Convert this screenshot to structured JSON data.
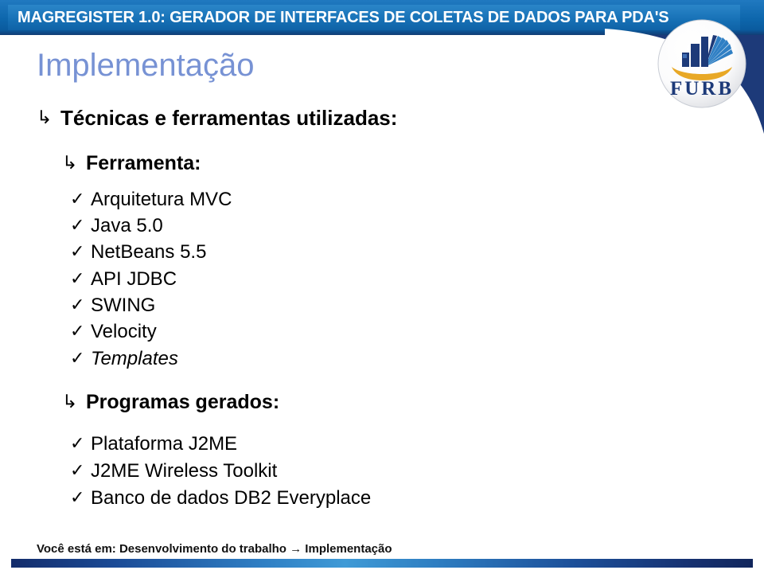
{
  "header": {
    "title": "MAGREGISTER 1.0: GERADOR DE INTERFACES DE COLETAS DE DADOS PARA PDA'S",
    "band_color": "#0d66ac",
    "corner_color": "#1d3a79"
  },
  "logo": {
    "name": "FURB",
    "text": "FURB",
    "arc_color": "#e8a826",
    "building_color": "#1d3a79",
    "fan_color": "#2f7fc4"
  },
  "slide": {
    "title": "Implementação",
    "title_color": "#7792d4"
  },
  "bullets": {
    "arrow_glyph": "↳",
    "check_glyph": "✓"
  },
  "sections": [
    {
      "level": 1,
      "label": "Técnicas e ferramentas utilizadas:",
      "marker": "arrow"
    },
    {
      "level": 2,
      "label": "Ferramenta:",
      "marker": "arrow"
    }
  ],
  "tools": {
    "heading": "Ferramenta:",
    "items": [
      {
        "label": "Arquitetura MVC",
        "italic": false
      },
      {
        "label": "Java 5.0",
        "italic": false
      },
      {
        "label": "NetBeans 5.5",
        "italic": false
      },
      {
        "label": "API JDBC",
        "italic": false
      },
      {
        "label": "SWING",
        "italic": false
      },
      {
        "label": "Velocity",
        "italic": false
      },
      {
        "label": "Templates",
        "italic": true
      }
    ]
  },
  "generated": {
    "heading": "Programas gerados:",
    "items": [
      {
        "label": "Plataforma J2ME",
        "italic": false
      },
      {
        "label": "J2ME Wireless Toolkit",
        "italic": false
      },
      {
        "label": "Banco de dados DB2 Everyplace",
        "italic": false
      }
    ]
  },
  "footer": {
    "prefix": "Você está em:",
    "path": "Desenvolvimento do trabalho",
    "arrow": "→",
    "current": "Implementação",
    "full": "Você está em: Desenvolvimento do trabalho → Implementação"
  }
}
